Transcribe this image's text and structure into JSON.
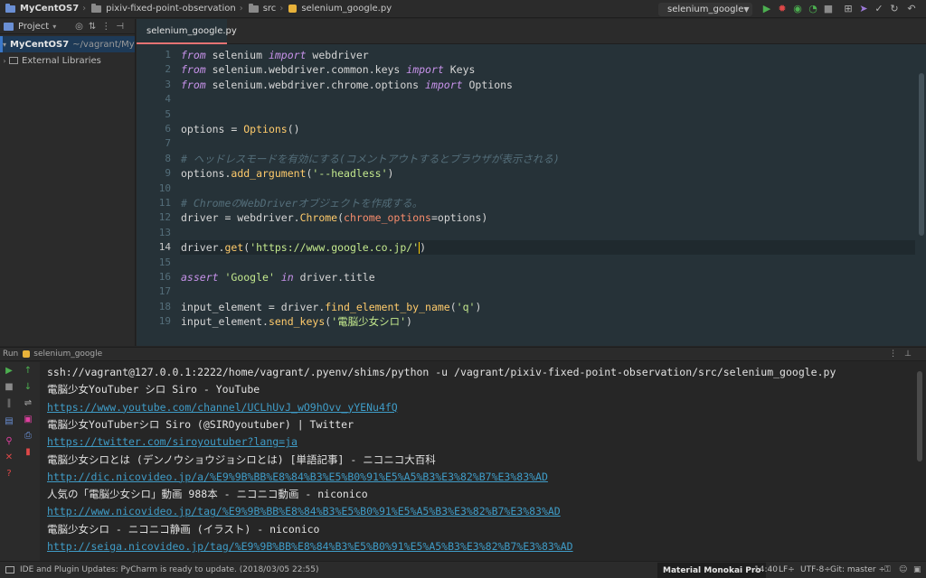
{
  "breadcrumb": [
    "MyCentOS7",
    "pixiv-fixed-point-observation",
    "src",
    "selenium_google.py"
  ],
  "run_config": {
    "label": "selenium_google"
  },
  "project": {
    "header": "Project",
    "items": [
      {
        "label": "MyCentOS7",
        "path": "~/vagrant/MyC"
      },
      {
        "label": "External Libraries"
      }
    ]
  },
  "editor": {
    "tab": "selenium_google.py",
    "current_line": 14,
    "lines": [
      [
        [
          "kw",
          "from"
        ],
        [
          "pl",
          " selenium "
        ],
        [
          "kw",
          "import"
        ],
        [
          "pl",
          " webdriver"
        ]
      ],
      [
        [
          "kw",
          "from"
        ],
        [
          "pl",
          " selenium.webdriver.common.keys "
        ],
        [
          "kw",
          "import"
        ],
        [
          "pl",
          " Keys"
        ]
      ],
      [
        [
          "kw",
          "from"
        ],
        [
          "pl",
          " selenium.webdriver.chrome.options "
        ],
        [
          "kw",
          "import"
        ],
        [
          "pl",
          " Options"
        ]
      ],
      [],
      [],
      [
        [
          "pl",
          "options = "
        ],
        [
          "fn",
          "Options"
        ],
        [
          "pl",
          "()"
        ]
      ],
      [],
      [
        [
          "cm",
          "# ヘッドレスモードを有効にする(コメントアウトするとブラウザが表示される)"
        ]
      ],
      [
        [
          "pl",
          "options."
        ],
        [
          "fn",
          "add_argument"
        ],
        [
          "pl",
          "("
        ],
        [
          "st",
          "'--headless'"
        ],
        [
          "pl",
          ")"
        ]
      ],
      [],
      [
        [
          "cm",
          "# ChromeのWebDriverオブジェクトを作成する。"
        ]
      ],
      [
        [
          "pl",
          "driver = webdriver."
        ],
        [
          "fn",
          "Chrome"
        ],
        [
          "pl",
          "("
        ],
        [
          "pm",
          "chrome_options"
        ],
        [
          "pl",
          "=options)"
        ]
      ],
      [],
      [
        [
          "pl",
          "driver."
        ],
        [
          "fn",
          "get"
        ],
        [
          "pl",
          "("
        ],
        [
          "st",
          "'https://www.google.co.jp/'"
        ],
        [
          "pl",
          ")"
        ]
      ],
      [],
      [
        [
          "kw",
          "assert"
        ],
        [
          "pl",
          " "
        ],
        [
          "st",
          "'Google'"
        ],
        [
          "pl",
          " "
        ],
        [
          "kw",
          "in"
        ],
        [
          "pl",
          " driver.title"
        ]
      ],
      [],
      [
        [
          "pl",
          "input_element = driver."
        ],
        [
          "fn",
          "find_element_by_name"
        ],
        [
          "pl",
          "("
        ],
        [
          "st",
          "'q'"
        ],
        [
          "pl",
          ")"
        ]
      ],
      [
        [
          "pl",
          "input_element."
        ],
        [
          "fn",
          "send_keys"
        ],
        [
          "pl",
          "("
        ],
        [
          "st",
          "'電脳少女シロ'"
        ],
        [
          "pl",
          ")"
        ]
      ]
    ]
  },
  "run": {
    "header": "Run",
    "config": "selenium_google",
    "output": [
      {
        "text": "ssh://vagrant@127.0.0.1:2222/home/vagrant/.pyenv/shims/python -u /vagrant/pixiv-fixed-point-observation/src/selenium_google.py",
        "link": false
      },
      {
        "text": "電脳少女YouTuber シロ Siro - YouTube",
        "link": false
      },
      {
        "text": "https://www.youtube.com/channel/UCLhUvJ_wO9hOvv_yYENu4fQ",
        "link": true
      },
      {
        "text": "電脳少女YouTuberシロ Siro (@SIROyoutuber) | Twitter",
        "link": false
      },
      {
        "text": "https://twitter.com/siroyoutuber?lang=ja",
        "link": true
      },
      {
        "text": "電脳少女シロとは (デンノウショウジョシロとは) [単語記事] - ニコニコ大百科",
        "link": false
      },
      {
        "text": "http://dic.nicovideo.jp/a/%E9%9B%BB%E8%84%B3%E5%B0%91%E5%A5%B3%E3%82%B7%E3%83%AD",
        "link": true
      },
      {
        "text": "人気の「電脳少女シロ」動画 988本 - ニコニコ動画 - niconico",
        "link": false
      },
      {
        "text": "http://www.nicovideo.jp/tag/%E9%9B%BB%E8%84%B3%E5%B0%91%E5%A5%B3%E3%82%B7%E3%83%AD",
        "link": true
      },
      {
        "text": "電脳少女シロ - ニコニコ静画 (イラスト) - niconico",
        "link": false
      },
      {
        "text": "http://seiga.nicovideo.jp/tag/%E9%9B%BB%E8%84%B3%E5%B0%91%E5%A5%B3%E3%82%B7%E3%83%AD",
        "link": true
      }
    ]
  },
  "status": {
    "message": "IDE and Plugin Updates: PyCharm is ready to update. (2018/03/05 22:55)",
    "theme": "Material Monokai Pro",
    "position": "14:40",
    "line_sep": "LF÷",
    "encoding": "UTF-8÷",
    "git": "Git: master ÷"
  },
  "colors": {
    "accent_tab": "#e57373",
    "link": "#3f9cc7",
    "run_green": "#4caf50",
    "stop_red": "#e04848"
  }
}
